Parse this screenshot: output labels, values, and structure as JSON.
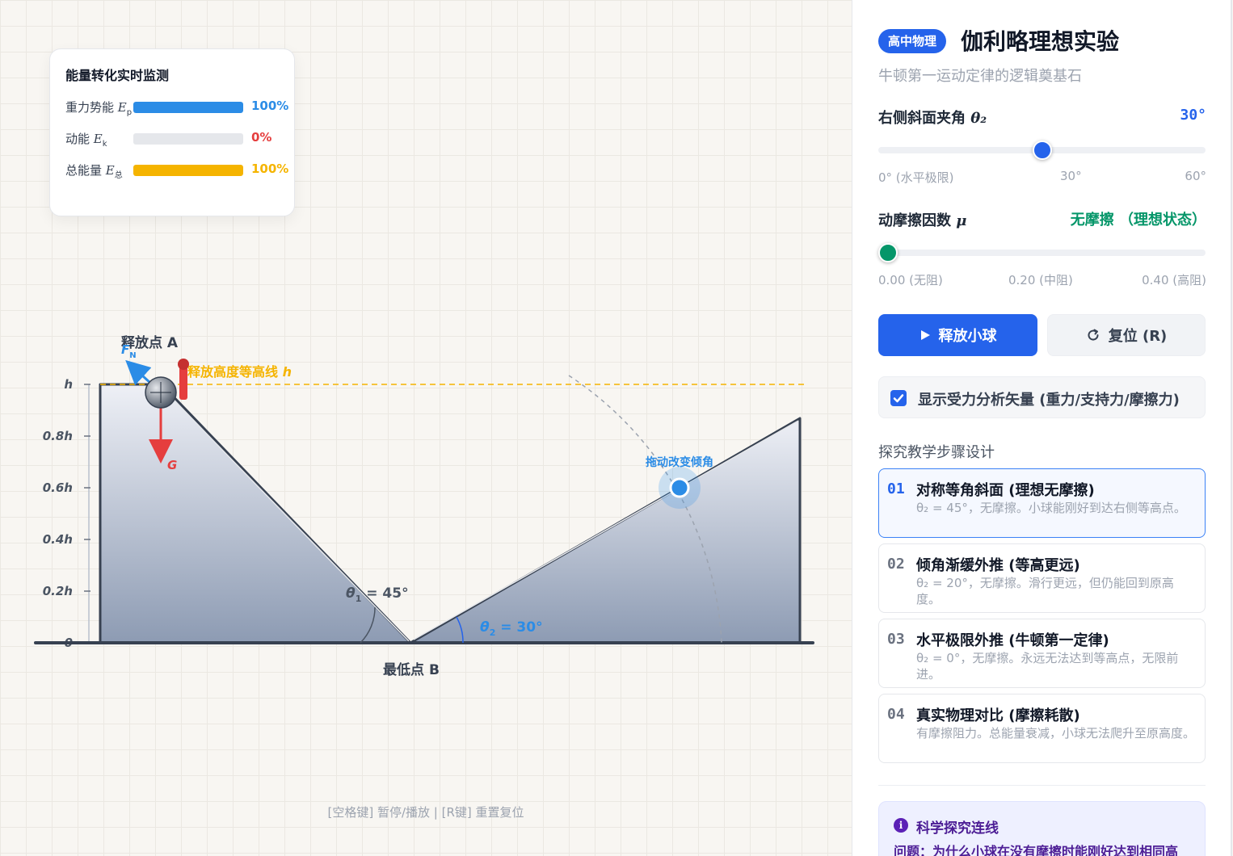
{
  "energy_monitor": {
    "title": "能量转化实时监测",
    "rows": [
      {
        "label": "重力势能 ",
        "sym": "E",
        "sub": "p",
        "percent": 100,
        "value": "100%",
        "color": "#2b8ce6"
      },
      {
        "label": "动能 ",
        "sym": "E",
        "sub": "k",
        "percent": 0,
        "value": "0%",
        "color": "#e53e3e"
      },
      {
        "label": "总能量 ",
        "sym": "E",
        "sub": "总",
        "percent": 100,
        "value": "100%",
        "color": "#f5b400"
      }
    ]
  },
  "scene": {
    "release_label": "释放点 A",
    "height_line_label": "释放高度等高线",
    "height_symbol": "h",
    "lowest_label": "最低点 B",
    "drag_hint": "拖动改变倾角",
    "force_n": "F",
    "force_n_sub": "N",
    "force_g": "G",
    "theta1_sym": "θ",
    "theta1_sub": "1",
    "theta1_val": " = 45°",
    "theta2_sym": "θ",
    "theta2_sub": "2",
    "theta2_val": " = 30°",
    "y_ticks": [
      "h",
      "0.8h",
      "0.6h",
      "0.4h",
      "0.2h",
      "0"
    ],
    "colors": {
      "accent": "#2563eb",
      "gravity": "#e53e3e",
      "height_line": "#f5b400",
      "normal": "#2b8ce6"
    }
  },
  "footer_hint": "[空格键] 暂停/播放  |  [R键] 重置复位",
  "panel": {
    "badge": "高中物理",
    "title": "伽利略理想实验",
    "subtitle": "牛顿第一运动定律的逻辑奠基石",
    "angle_control": {
      "label": "右侧斜面夹角 ",
      "sym": "θ₂",
      "value": "30°",
      "fraction": 0.5,
      "ticks": [
        "0° (水平极限)",
        "30°",
        "60°"
      ]
    },
    "friction_control": {
      "label": "动摩擦因数 ",
      "sym": "μ",
      "value": "无摩擦 （理想状态）",
      "fraction": 0,
      "ticks": [
        "0.00 (无阻)",
        "0.20 (中阻)",
        "0.40 (高阻)"
      ]
    },
    "release_button": "释放小球",
    "reset_button": "复位 (R)",
    "show_forces_label": "显示受力分析矢量 (重力/支持力/摩擦力)",
    "show_forces_checked": true,
    "steps_title": "探究教学步骤设计",
    "steps": [
      {
        "num": "01",
        "title": "对称等角斜面 (理想无摩擦)",
        "desc": "θ₂ = 45°，无摩擦。小球能刚好到达右侧等高点。"
      },
      {
        "num": "02",
        "title": "倾角渐缓外推 (等高更远)",
        "desc": "θ₂ = 20°，无摩擦。滑行更远，但仍能回到原高度。"
      },
      {
        "num": "03",
        "title": "水平极限外推 (牛顿第一定律)",
        "desc": "θ₂ = 0°，无摩擦。永远无法达到等高点，无限前进。"
      },
      {
        "num": "04",
        "title": "真实物理对比 (摩擦耗散)",
        "desc": "有摩擦阻力。总能量衰减，小球无法爬升至原高度。"
      }
    ],
    "science": {
      "icon": "i",
      "title": "科学探究连线",
      "question": "问题：为什么小球在没有摩擦时能刚好达到相同高"
    }
  }
}
